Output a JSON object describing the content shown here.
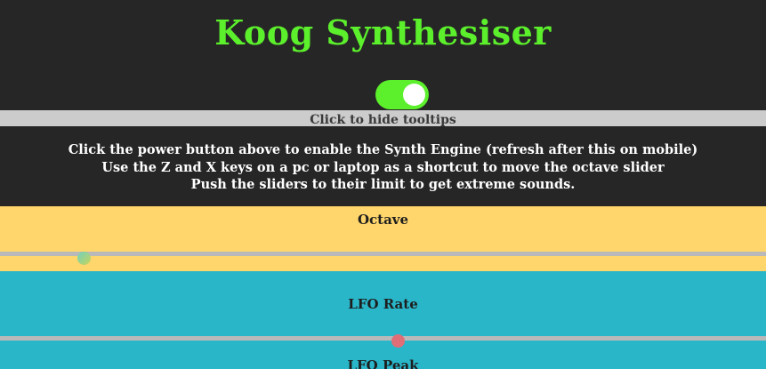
{
  "header": {
    "title": "Koog Synthesiser",
    "power_toggle": {
      "state": "on",
      "accent": "#5cf02c"
    }
  },
  "tooltips": {
    "toggle_label": "Click to hide tooltips"
  },
  "instructions": {
    "lines": [
      "Click the power button above to enable the Synth Engine (refresh after this on mobile)",
      "Use the Z and X keys on a pc or laptop as a shortcut to move the octave slider",
      "Push the sliders to their limit to get extreme sounds."
    ]
  },
  "controls": {
    "octave": {
      "label": "Octave",
      "value_fraction": 0.11,
      "color": "#ffd66b"
    },
    "lfo_rate": {
      "label": "LFO Rate",
      "value_fraction": 0.52,
      "color": "#29b6c9"
    },
    "lfo_peak": {
      "label": "LFO Peak"
    }
  }
}
